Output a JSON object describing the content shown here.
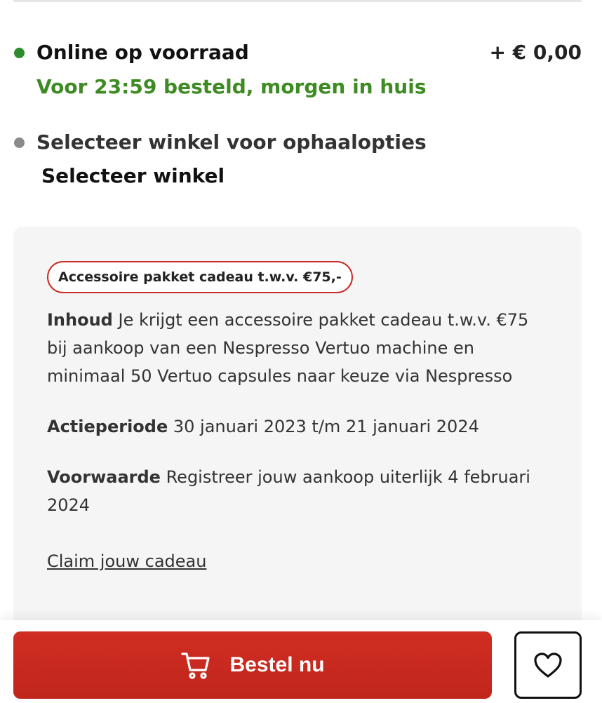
{
  "stock": {
    "title": "Online op voorraad",
    "price": "+ € 0,00",
    "delivery_note": "Voor 23:59 besteld, morgen in huis",
    "status_color": "#2e8b2e"
  },
  "pickup": {
    "title": "Selecteer winkel voor ophaalopties",
    "link_label": "Selecteer winkel",
    "status_color": "#8a8a8a"
  },
  "promo": {
    "badge": "Accessoire pakket cadeau t.w.v. €75,-",
    "rows": [
      {
        "label": "Inhoud",
        "text": "Je krijgt een accessoire pakket cadeau t.w.v. €75 bij aankoop van een Nespresso Vertuo machine en minimaal 50 Vertuo capsules naar keuze via Nespresso"
      },
      {
        "label": "Actieperiode",
        "text": "30 januari 2023 t/m 21 januari 2024"
      },
      {
        "label": "Voorwaarde",
        "text": "Registreer jouw aankoop uiterlijk 4 februari 2024"
      }
    ],
    "claim_link": "Claim jouw cadeau"
  },
  "actions": {
    "order_label": "Bestel nu",
    "order_icon": "cart-icon",
    "wishlist_icon": "heart-icon",
    "brand_color": "#cc2a20"
  }
}
